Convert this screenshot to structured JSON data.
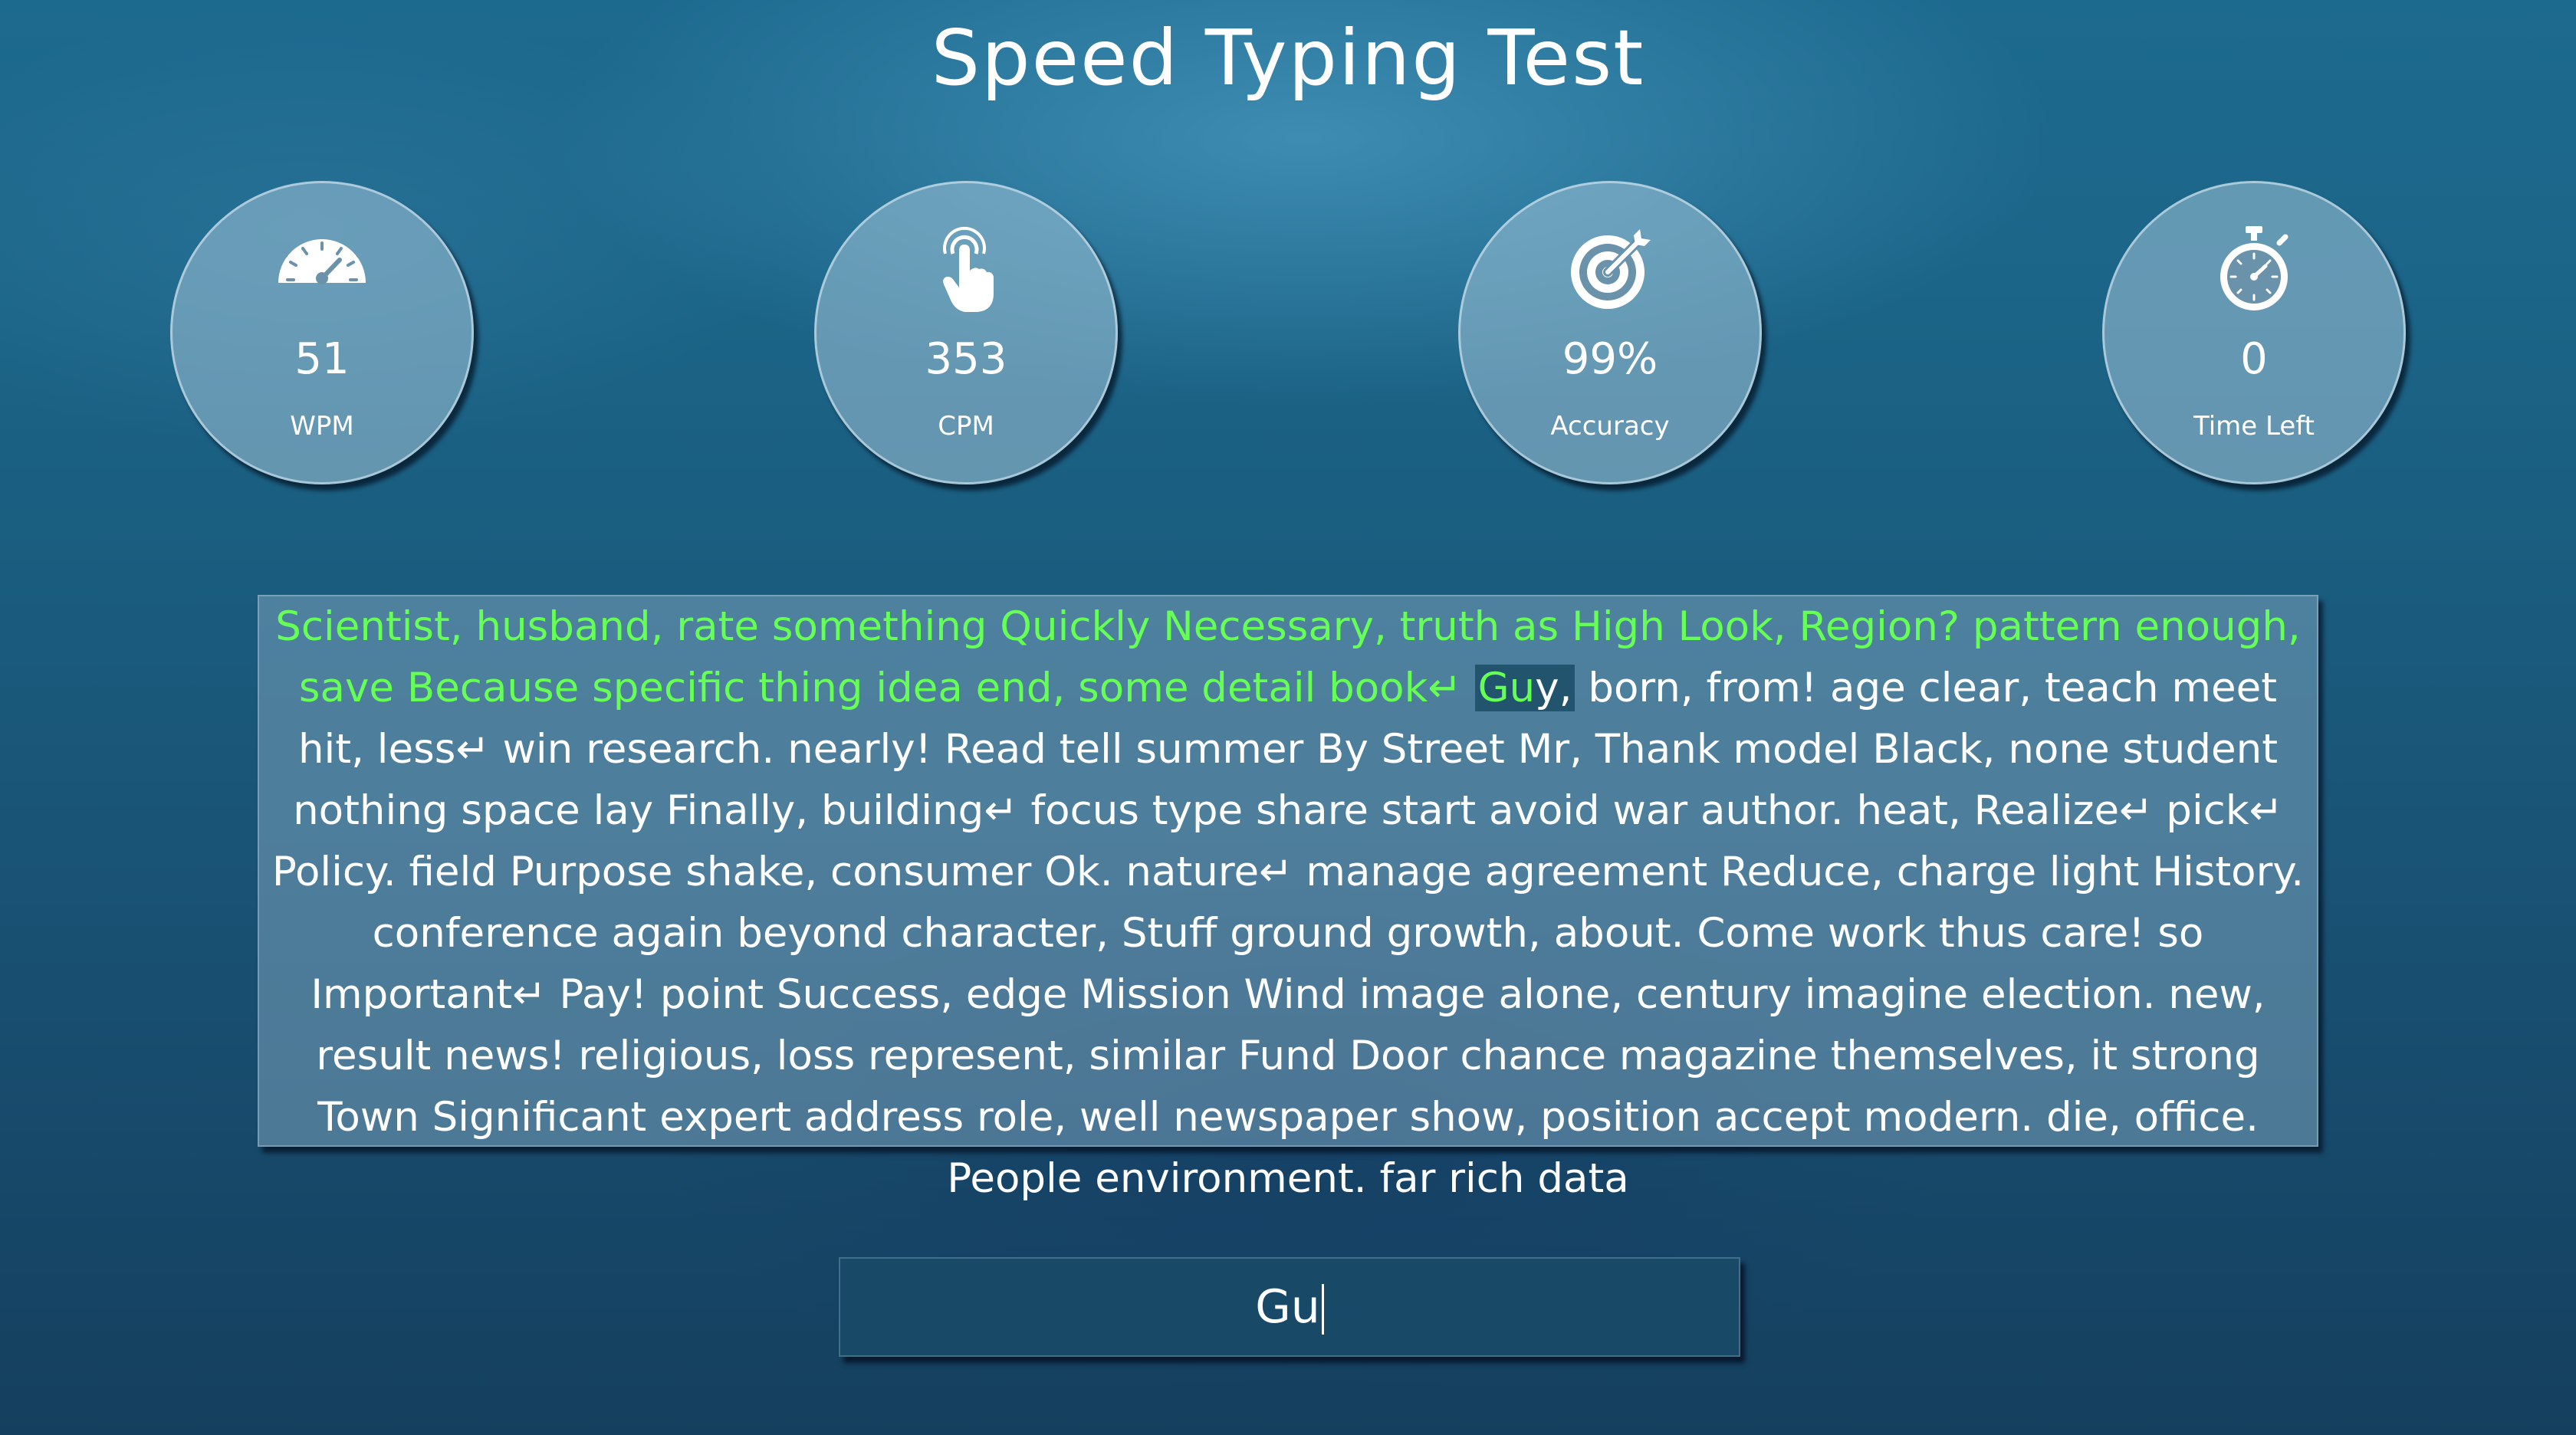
{
  "app": {
    "title": "Speed Typing Test"
  },
  "stats": {
    "wpm": {
      "value": "51",
      "label": "WPM",
      "icon": "speedometer-icon"
    },
    "cpm": {
      "value": "353",
      "label": "CPM",
      "icon": "pointer-hand-icon"
    },
    "accuracy": {
      "value": "99%",
      "label": "Accuracy",
      "icon": "target-icon"
    },
    "time_left": {
      "value": "0",
      "label": "Time Left",
      "icon": "stopwatch-icon"
    }
  },
  "passage": {
    "completed_text": "Scientist, husband, rate something Quickly Necessary, truth as High Look, Region? pattern enough, save Because specific thing idea end, some detail book↵",
    "current_word_typed": "Gu",
    "current_word_rest": "y,",
    "remaining_text": "born, from! age clear, teach meet hit, less↵ win research. nearly! Read tell summer By Street Mr, Thank model Black, none student nothing space lay Finally, building↵ focus type share start avoid war author. heat, Realize↵ pick↵ Policy. field Purpose shake, consumer Ok. nature↵ manage agreement Reduce, charge light History. conference again beyond character, Stuff ground growth, about. Come work thus care! so Important↵ Pay! point Success, edge Mission Wind image alone, century imagine election. new, result news! religious, loss represent, similar Fund Door chance magazine themselves, it strong Town Significant expert address role, well newspaper show, position accept modern. die, office. People environment. far rich data",
    "colors": {
      "completed": "#66ff55",
      "pending": "#ffffff"
    }
  },
  "input": {
    "value": "Gu"
  }
}
